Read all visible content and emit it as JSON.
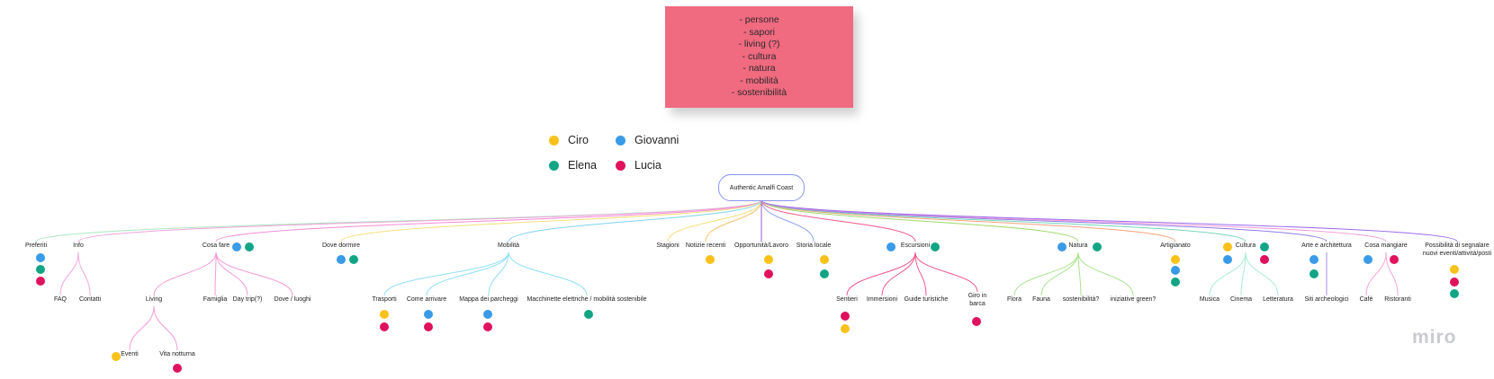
{
  "sticky_note": {
    "lines": [
      "- persone",
      "- sapori",
      "- living (?)",
      "- cultura",
      "- natura",
      "- mobilità",
      "- sostenibilità"
    ]
  },
  "colors": {
    "ciro": "#f8c21b",
    "giovanni": "#3a9be8",
    "elena": "#12a585",
    "lucia": "#e0125d",
    "sticky": "#f06a80"
  },
  "legend": [
    {
      "name": "Ciro",
      "color": "#f8c21b"
    },
    {
      "name": "Giovanni",
      "color": "#3a9be8"
    },
    {
      "name": "Elena",
      "color": "#12a585"
    },
    {
      "name": "Lucia",
      "color": "#e0125d"
    }
  ],
  "mindmap": {
    "root": "Authentic Amalfi Coast",
    "branches": [
      {
        "label": "Preferiti"
      },
      {
        "label": "Info",
        "children": [
          {
            "label": "FAQ"
          },
          {
            "label": "Contatti"
          }
        ]
      },
      {
        "label": "Cosa fare",
        "children": [
          {
            "label": "Living",
            "children": [
              {
                "label": "Eventi"
              },
              {
                "label": "Vita notturna"
              }
            ]
          },
          {
            "label": "Famiglia"
          },
          {
            "label": "Day trip(?)"
          },
          {
            "label": "Dove / luoghi"
          }
        ]
      },
      {
        "label": "Dove dormire"
      },
      {
        "label": "Mobilità",
        "children": [
          {
            "label": "Trasporti"
          },
          {
            "label": "Come arrivare"
          },
          {
            "label": "Mappa dei parcheggi"
          },
          {
            "label": "Macchinette elettriche / mobilità sostenibile"
          }
        ]
      },
      {
        "label": "Stagioni"
      },
      {
        "label": "Notizie recenti"
      },
      {
        "label": "Opportunità/Lavoro"
      },
      {
        "label": "Storia locale"
      },
      {
        "label": "Escursioni",
        "children": [
          {
            "label": "Sentieri"
          },
          {
            "label": "Immersioni"
          },
          {
            "label": "Guide turistiche"
          },
          {
            "label": "Giro in barca"
          }
        ]
      },
      {
        "label": "Natura",
        "children": [
          {
            "label": "Flora"
          },
          {
            "label": "Fauna"
          },
          {
            "label": "sostenibilità?"
          },
          {
            "label": "iniziative green?"
          }
        ]
      },
      {
        "label": "Artigianato"
      },
      {
        "label": "Cultura",
        "children": [
          {
            "label": "Musica"
          },
          {
            "label": "Cinema"
          },
          {
            "label": "Letteratura"
          }
        ]
      },
      {
        "label": "Arte e architettura",
        "children": [
          {
            "label": "Siti archeologici"
          }
        ]
      },
      {
        "label": "Cosa mangiare",
        "children": [
          {
            "label": "Café"
          },
          {
            "label": "Ristoranti"
          }
        ]
      },
      {
        "label": "Possibilità di segnalare nuovi eventi/attività/posti"
      }
    ]
  },
  "logo": "miro"
}
